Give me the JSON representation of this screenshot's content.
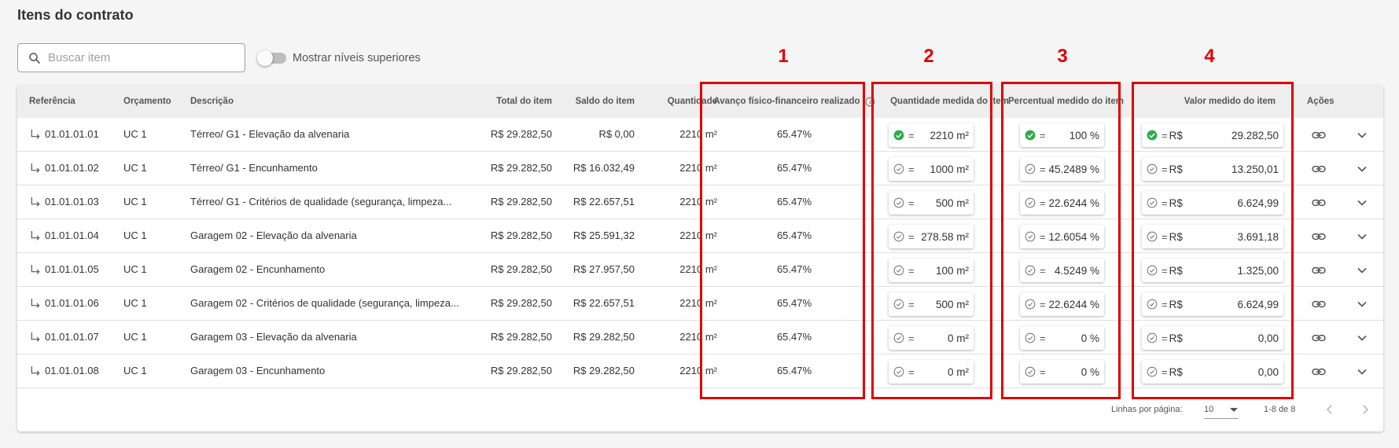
{
  "page_title": "Itens do contrato",
  "search": {
    "placeholder": "Buscar item",
    "value": ""
  },
  "toggle": {
    "label": "Mostrar níveis superiores",
    "on": false
  },
  "columns": {
    "referencia": "Referência",
    "orcamento": "Orçamento",
    "descricao": "Descrição",
    "total": "Total do item",
    "saldo": "Saldo do item",
    "quantidade": "Quantidade",
    "avanco": "Avanço físico-financeiro realizado",
    "qtd_medida": "Quantidade medida do item",
    "percentual": "Percentual medido do item",
    "valor": "Valor medido do item",
    "acoes": "Ações"
  },
  "rows": [
    {
      "ref": "01.01.01.01",
      "orc": "UC 1",
      "desc": "Térreo/ G1 - Elevação da alvenaria",
      "total": "R$ 29.282,50",
      "saldo": "R$ 0,00",
      "qtd": "2210 m²",
      "avanco": "65.47%",
      "complete": true,
      "eq": "=",
      "qtd_med": "2210 m²",
      "pct": "100 %",
      "cur": "R$",
      "valor": "29.282,50"
    },
    {
      "ref": "01.01.01.02",
      "orc": "UC 1",
      "desc": "Térreo/ G1 - Encunhamento",
      "total": "R$ 29.282,50",
      "saldo": "R$ 16.032,49",
      "qtd": "2210 m²",
      "avanco": "65.47%",
      "complete": false,
      "eq": "=",
      "qtd_med": "1000 m²",
      "pct": "45.2489 %",
      "cur": "R$",
      "valor": "13.250,01"
    },
    {
      "ref": "01.01.01.03",
      "orc": "UC 1",
      "desc": "Térreo/ G1 - Critérios de qualidade (segurança, limpeza...",
      "total": "R$ 29.282,50",
      "saldo": "R$ 22.657,51",
      "qtd": "2210 m²",
      "avanco": "65.47%",
      "complete": false,
      "eq": "=",
      "qtd_med": "500 m²",
      "pct": "22.6244 %",
      "cur": "R$",
      "valor": "6.624,99"
    },
    {
      "ref": "01.01.01.04",
      "orc": "UC 1",
      "desc": "Garagem 02 - Elevação da alvenaria",
      "total": "R$ 29.282,50",
      "saldo": "R$ 25.591,32",
      "qtd": "2210 m²",
      "avanco": "65.47%",
      "complete": false,
      "eq": "=",
      "qtd_med": "278.58 m²",
      "pct": "12.6054 %",
      "cur": "R$",
      "valor": "3.691,18"
    },
    {
      "ref": "01.01.01.05",
      "orc": "UC 1",
      "desc": "Garagem 02 - Encunhamento",
      "total": "R$ 29.282,50",
      "saldo": "R$ 27.957,50",
      "qtd": "2210 m²",
      "avanco": "65.47%",
      "complete": false,
      "eq": "=",
      "qtd_med": "100 m²",
      "pct": "4.5249 %",
      "cur": "R$",
      "valor": "1.325,00"
    },
    {
      "ref": "01.01.01.06",
      "orc": "UC 1",
      "desc": "Garagem 02 - Critérios de qualidade (segurança, limpeza...",
      "total": "R$ 29.282,50",
      "saldo": "R$ 22.657,51",
      "qtd": "2210 m²",
      "avanco": "65.47%",
      "complete": false,
      "eq": "=",
      "qtd_med": "500 m²",
      "pct": "22.6244 %",
      "cur": "R$",
      "valor": "6.624,99"
    },
    {
      "ref": "01.01.01.07",
      "orc": "UC 1",
      "desc": "Garagem 03 - Elevação da alvenaria",
      "total": "R$ 29.282,50",
      "saldo": "R$ 29.282,50",
      "qtd": "2210 m²",
      "avanco": "65.47%",
      "complete": false,
      "eq": "=",
      "qtd_med": "0 m²",
      "pct": "0 %",
      "cur": "R$",
      "valor": "0,00"
    },
    {
      "ref": "01.01.01.08",
      "orc": "UC 1",
      "desc": "Garagem 03 - Encunhamento",
      "total": "R$ 29.282,50",
      "saldo": "R$ 29.282,50",
      "qtd": "2210 m²",
      "avanco": "65.47%",
      "complete": false,
      "eq": "=",
      "qtd_med": "0 m²",
      "pct": "0 %",
      "cur": "R$",
      "valor": "0,00"
    }
  ],
  "pagination": {
    "rows_label": "Linhas por página:",
    "rows_value": "10",
    "range": "1-8 de 8"
  },
  "annotations": [
    "1",
    "2",
    "3",
    "4"
  ],
  "icons": {
    "search": "search-icon",
    "info": "info-icon",
    "row": "subdirectory-arrow-icon",
    "status": "check-circle-icon",
    "link": "link-icon",
    "expand": "chevron-down-icon"
  },
  "colors": {
    "check_green": "#2eaa4a",
    "annotation_red": "#e00000",
    "header_bg": "#eeeeee"
  }
}
